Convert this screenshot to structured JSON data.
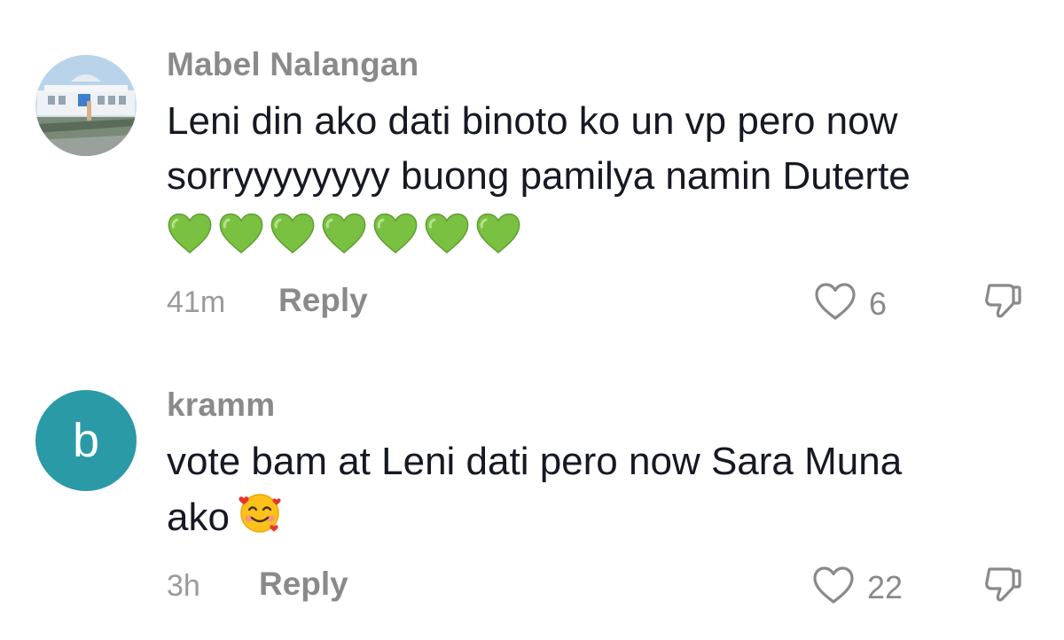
{
  "colors": {
    "text": "#161823",
    "muted": "#8a8a8a",
    "avatar_letter_bg": "#2a9aa7",
    "heart_emoji": "#7ac142"
  },
  "comments": [
    {
      "author": "Mabel Nalangan",
      "avatar": "photo",
      "text_line_1": "Leni din ako dati binoto ko un vp pero now",
      "text_line_2": "sorryyyyyyyy buong pamilya namin Duterte",
      "emojis": [
        "green-heart",
        "green-heart",
        "green-heart",
        "green-heart",
        "green-heart",
        "green-heart",
        "green-heart"
      ],
      "time": "41m",
      "reply_label": "Reply",
      "likes": "6",
      "like_icon": "heart-outline-icon",
      "dislike_icon": "thumbs-down-icon"
    },
    {
      "author": "kramm",
      "avatar": "letter",
      "avatar_letter": "b",
      "text_line_1": "vote bam at Leni dati pero now Sara Muna",
      "text_line_2": "ako",
      "emojis": [
        "smiling-face-with-hearts"
      ],
      "time": "3h",
      "reply_label": "Reply",
      "likes": "22",
      "like_icon": "heart-outline-icon",
      "dislike_icon": "thumbs-down-icon"
    }
  ]
}
